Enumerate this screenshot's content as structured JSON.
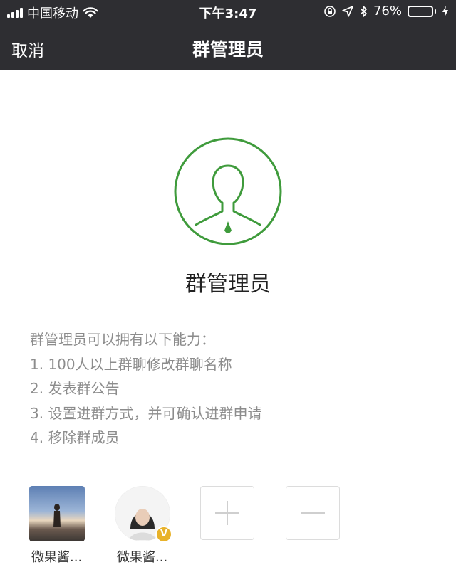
{
  "status_bar": {
    "carrier": "中国移动",
    "time": "下午3:47",
    "battery": "76%",
    "battery_level": 0.76,
    "battery_color": "#4cd964"
  },
  "nav": {
    "cancel_label": "取消",
    "title": "群管理员"
  },
  "main": {
    "icon": "admin-person-icon",
    "icon_color": "#3f9b3c",
    "title": "群管理员",
    "description_heading": "群管理员可以拥有以下能力：",
    "abilities": [
      "1. 100人以上群聊修改群聊名称",
      "2. 发表群公告",
      "3. 设置进群方式，并可确认进群申请",
      "4. 移除群成员"
    ]
  },
  "members": [
    {
      "name": "微果酱...",
      "badge": ""
    },
    {
      "name": "微果酱...",
      "badge": "V"
    }
  ],
  "actions": {
    "add_icon": "plus-icon",
    "remove_icon": "minus-icon"
  }
}
